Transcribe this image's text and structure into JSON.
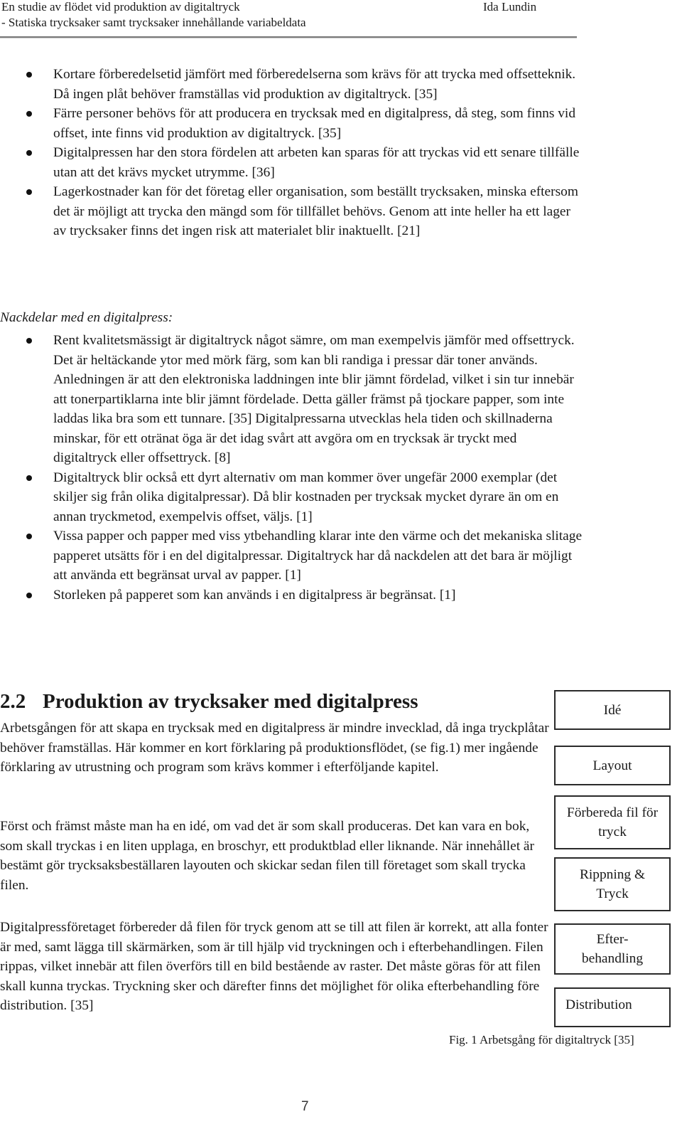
{
  "header": {
    "title_line1": "En studie av flödet vid produktion av digitaltryck",
    "title_line2": "- Statiska trycksaker samt trycksaker innehållande variabeldata",
    "author": "Ida Lundin"
  },
  "advantages": [
    "Kortare förberedelsetid jämfört med förberedelserna som krävs för att trycka med offsetteknik. Då ingen plåt behöver framställas vid produktion av digitaltryck. [35]",
    "Färre personer behövs för att producera en trycksak med en digitalpress, då steg, som finns vid offset, inte finns vid produktion av digitaltryck. [35]",
    "Digitalpressen har den stora fördelen att arbeten kan sparas för att tryckas vid ett senare tillfälle utan att det krävs mycket utrymme. [36]",
    "Lagerkostnader kan för det företag eller organisation, som beställt trycksaken, minska eftersom det är möjligt att trycka den mängd som för tillfället behövs. Genom att inte heller ha ett lager av trycksaker finns det ingen risk att materialet blir inaktuellt. [21]"
  ],
  "disadvantages_heading": "Nackdelar med en digitalpress:",
  "disadvantages": [
    "Rent kvalitetsmässigt är digitaltryck något sämre, om man exempelvis jämför med offsettryck. Det är heltäckande ytor med mörk färg, som kan bli randiga i pressar där toner används. Anledningen är att den elektroniska laddningen inte blir jämnt fördelad, vilket i sin tur innebär att tonerpartiklarna inte blir jämnt fördelade. Detta gäller främst på tjockare papper, som inte laddas lika bra som ett tunnare. [35] Digitalpressarna utvecklas hela tiden och skillnaderna minskar, för ett otränat öga är det idag svårt att avgöra om en trycksak är tryckt med digitaltryck eller offsettryck. [8]",
    "Digitaltryck blir också ett dyrt alternativ om man kommer över ungefär 2000 exemplar (det skiljer sig från olika digitalpressar). Då blir kostnaden per trycksak mycket dyrare än om en annan tryckmetod, exempelvis offset, väljs. [1]",
    "Vissa papper och papper med viss ytbehandling klarar inte den värme och det mekaniska slitage papperet utsätts för i en del digitalpressar. Digitaltryck har då nackdelen att det bara är möjligt att använda ett begränsat urval av papper. [1]",
    "Storleken på papperet som kan används i en digitalpress är begränsat. [1]"
  ],
  "section": {
    "number": "2.2",
    "title": "Produktion av trycksaker med digitalpress",
    "paragraphs": [
      "Arbetsgången för att skapa en trycksak med en digitalpress är mindre invecklad, då inga tryckplåtar behöver framställas. Här kommer en kort förklaring på produktionsflödet, (se fig.1) mer ingående förklaring av utrustning och program som krävs kommer i efterföljande kapitel.",
      "Först och främst måste man ha en idé, om vad det är som skall produceras. Det kan vara en bok, som skall tryckas i en liten upplaga, en broschyr, ett produktblad eller liknande. När innehållet är bestämt gör trycksaksbeställaren layouten och skickar sedan filen till företaget som skall trycka filen.",
      "Digitalpressföretaget förbereder då filen för tryck genom att se till att filen är korrekt, att alla fonter är med, samt lägga till skärmärken, som är till hjälp vid tryckningen och i efterbehandlingen. Filen rippas, vilket innebär att filen överförs till en bild bestående av raster. Det måste göras för att filen skall kunna tryckas. Tryckning sker och därefter finns det möjlighet för olika efterbehandling före distribution. [35]"
    ]
  },
  "figure": {
    "steps": [
      "Idé",
      "Layout",
      "Förbereda fil för tryck",
      "Rippning & Tryck",
      "Efter-behandling",
      "Distribution"
    ],
    "caption": "Fig. 1 Arbetsgång för digitaltryck [35]"
  },
  "page_number": "7"
}
